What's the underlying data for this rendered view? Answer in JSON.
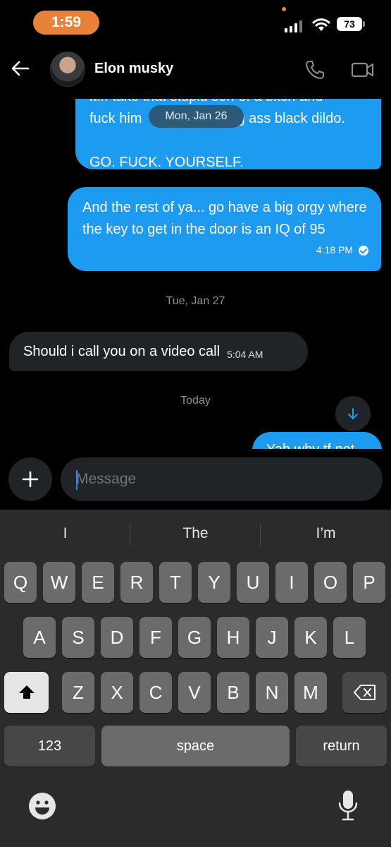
{
  "status_bar": {
    "time": "1:59",
    "battery": "73"
  },
  "header": {
    "contact_name": "Elon musky"
  },
  "chat": {
    "bubble1_lines": [
      "it... take that stupid son of a bitch and",
      "fuck him",
      "g ass black dildo.",
      "",
      "GO. FUCK. YOURSELF."
    ],
    "date_pill": "Mon, Jan 26",
    "bubble2_text": "And the rest of ya... go have a big orgy where the key to get in the door is an IQ of 95",
    "bubble2_time": "4:18 PM",
    "sep1": "Tue, Jan 27",
    "incoming_text": "Should i call you on a video call",
    "incoming_time": "5:04 AM",
    "sep2": "Today",
    "peek_text": "Yah why tf not"
  },
  "composer": {
    "placeholder": "Message"
  },
  "keyboard": {
    "suggestions": [
      "I",
      "The",
      "I’m"
    ],
    "row1": [
      "Q",
      "W",
      "E",
      "R",
      "T",
      "Y",
      "U",
      "I",
      "O",
      "P"
    ],
    "row2": [
      "A",
      "S",
      "D",
      "F",
      "G",
      "H",
      "J",
      "K",
      "L"
    ],
    "row3": [
      "Z",
      "X",
      "C",
      "V",
      "B",
      "N",
      "M"
    ],
    "numbers_label": "123",
    "space_label": "space",
    "return_label": "return"
  },
  "colors": {
    "accent": "#1d9bf0",
    "status_pill": "#e8823a"
  }
}
